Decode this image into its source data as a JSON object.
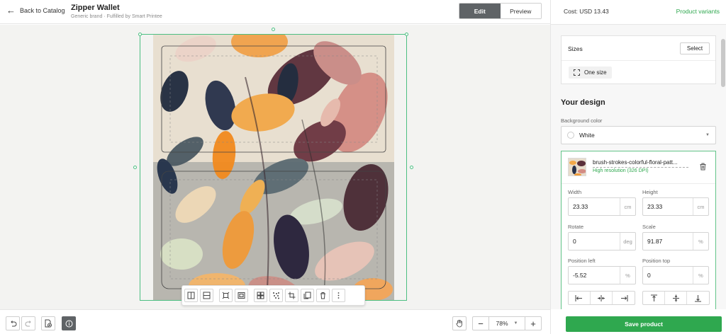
{
  "header": {
    "back_label": "Back to Catalog",
    "product_title": "Zipper Wallet",
    "product_subtitle": "Generic brand · Fulfilled by Smart Printee",
    "mode_tabs": [
      {
        "label": "Edit",
        "active": true
      },
      {
        "label": "Preview",
        "active": false
      }
    ]
  },
  "canvas": {
    "background": "#f3f3f1",
    "selection_color": "#4cbf82",
    "toolbar_icons": [
      "split-vertical-icon",
      "split-horizontal-icon",
      "fit-width-icon",
      "fit-frame-icon",
      "pattern-grid-icon",
      "scatter-icon",
      "crop-icon",
      "duplicate-icon",
      "delete-icon",
      "more-icon"
    ]
  },
  "bottom_bar": {
    "undo_icon": "undo-icon",
    "redo_icon": "redo-icon",
    "zoom_value": "78%"
  },
  "panel": {
    "cost": "Cost: USD 13.43",
    "product_variants_link": "Product variants",
    "sizes": {
      "label": "Sizes",
      "select_label": "Select",
      "selected_size": "One size"
    },
    "your_design_title": "Your design",
    "background_color": {
      "label": "Background color",
      "value": "White"
    },
    "layer": {
      "file_name": "brush-strokes-colorful-floral-patt...",
      "resolution": "High resolution (326 DPI)",
      "fields": {
        "width": {
          "label": "Width",
          "value": "23.33",
          "unit": "cm"
        },
        "height": {
          "label": "Height",
          "value": "23.33",
          "unit": "cm"
        },
        "rotate": {
          "label": "Rotate",
          "value": "0",
          "unit": "deg"
        },
        "scale": {
          "label": "Scale",
          "value": "91.87",
          "unit": "%"
        },
        "position_left": {
          "label": "Position left",
          "value": "-5.52",
          "unit": "%"
        },
        "position_top": {
          "label": "Position top",
          "value": "0",
          "unit": "%"
        }
      }
    },
    "save_label": "Save product",
    "accent_color": "#2fa84f"
  }
}
